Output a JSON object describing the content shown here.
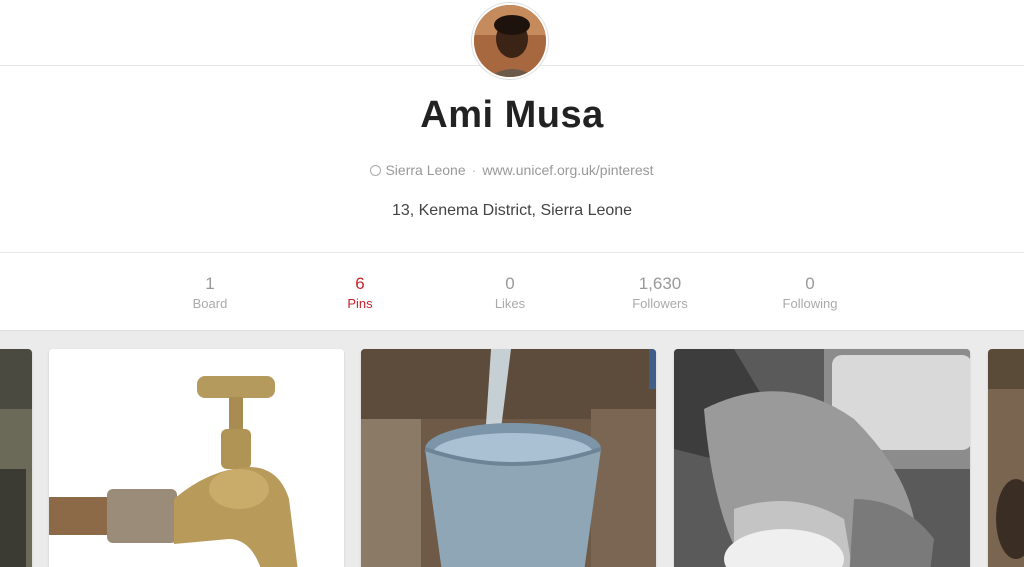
{
  "profile": {
    "name": "Ami Musa",
    "location": "Sierra Leone",
    "website": "www.unicef.org.uk/pinterest",
    "about": "13, Kenema District, Sierra Leone"
  },
  "stats": [
    {
      "value": "1",
      "label": "Board"
    },
    {
      "value": "6",
      "label": "Pins"
    },
    {
      "value": "0",
      "label": "Likes"
    },
    {
      "value": "1,630",
      "label": "Followers"
    },
    {
      "value": "0",
      "label": "Following"
    }
  ],
  "active_tab": "Pins",
  "colors": {
    "accent": "#c8232c",
    "muted": "#999999",
    "grid_bg": "#ebebeb"
  },
  "pins": [
    {
      "name": "partial-pin-left"
    },
    {
      "name": "water-tap-pin"
    },
    {
      "name": "water-bucket-pin"
    },
    {
      "name": "hand-washing-pin"
    },
    {
      "name": "partial-pin-right"
    }
  ]
}
